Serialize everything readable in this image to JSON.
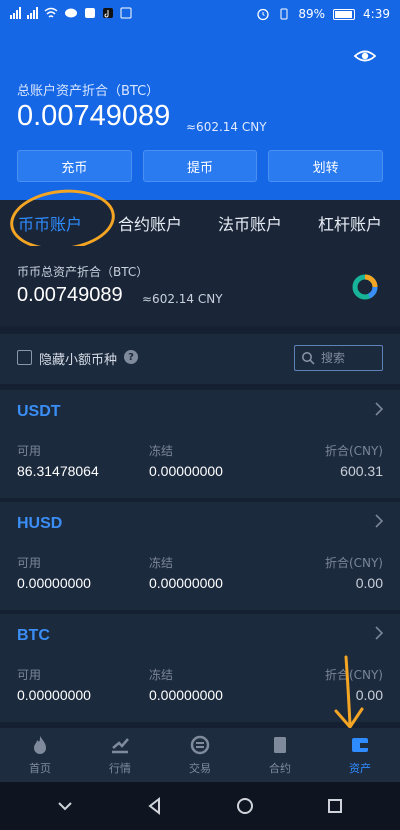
{
  "status_bar": {
    "time": "4:39",
    "battery": "89%"
  },
  "header": {
    "total_label": "总账户资产折合（BTC）",
    "total_value": "0.00749089",
    "total_cny": "≈602.14 CNY",
    "buttons": [
      "充币",
      "提币",
      "划转"
    ]
  },
  "tabs": [
    "币币账户",
    "合约账户",
    "法币账户",
    "杠杆账户"
  ],
  "summary": {
    "label": "币币总资产折合（BTC）",
    "value": "0.00749089",
    "cny": "≈602.14 CNY"
  },
  "filter": {
    "hide_small_label": "隐藏小额币种",
    "search_placeholder": "搜索"
  },
  "coins": [
    {
      "symbol": "USDT",
      "available_label": "可用",
      "frozen_label": "冻结",
      "equiv_label": "折合(CNY)",
      "available": "86.31478064",
      "frozen": "0.00000000",
      "equiv": "600.31"
    },
    {
      "symbol": "HUSD",
      "available_label": "可用",
      "frozen_label": "冻结",
      "equiv_label": "折合(CNY)",
      "available": "0.00000000",
      "frozen": "0.00000000",
      "equiv": "0.00"
    },
    {
      "symbol": "BTC",
      "available_label": "可用",
      "frozen_label": "冻结",
      "equiv_label": "折合(CNY)",
      "available": "0.00000000",
      "frozen": "0.00000000",
      "equiv": "0.00"
    }
  ],
  "nav": [
    "首页",
    "行情",
    "交易",
    "合约",
    "资产"
  ],
  "colors": {
    "header_blue": "#1567e6",
    "accent": "#2f8cff",
    "annotation": "#f4a523"
  }
}
